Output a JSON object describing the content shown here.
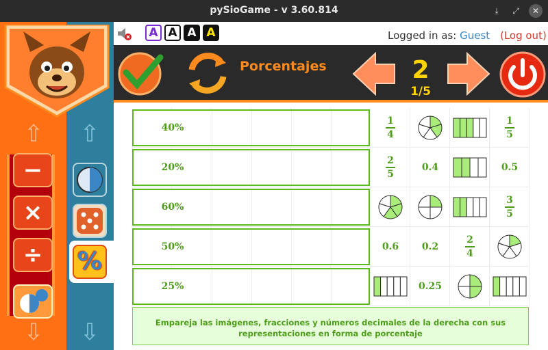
{
  "window": {
    "title": "pySioGame - v 3.60.814",
    "minimize_symbol": "⤓",
    "maximize_symbol": "⤢",
    "close_symbol": "✕"
  },
  "font_options": [
    {
      "label": "A",
      "bg": "#ffffff",
      "fg": "#7a2bd6",
      "border": "#7a2bd6"
    },
    {
      "label": "A",
      "bg": "#ffffff",
      "fg": "#111111",
      "border": "#111111"
    },
    {
      "label": "A",
      "bg": "#111111",
      "fg": "#ffffff",
      "border": "#111111"
    },
    {
      "label": "A",
      "bg": "#111111",
      "fg": "#ffe600",
      "border": "#111111"
    }
  ],
  "login": {
    "prefix": "Logged in as:",
    "user": "Guest",
    "logout": "(Log out)"
  },
  "toolbar": {
    "game_title": "Porcentajes",
    "level": "2",
    "progress": "1/5"
  },
  "nav": {
    "up_arrow": "⇧",
    "down_arrow": "⇩"
  },
  "operations": [
    {
      "symbol": "−",
      "name": "subtract"
    },
    {
      "symbol": "×",
      "name": "multiply"
    },
    {
      "symbol": "÷",
      "name": "divide"
    }
  ],
  "category_active_label": "%",
  "targets": [
    "40%",
    "20%",
    "60%",
    "50%",
    "25%"
  ],
  "choices": [
    [
      {
        "kind": "fraction",
        "num": "1",
        "den": "4"
      },
      {
        "kind": "pie",
        "slices": 5,
        "filled": 2
      },
      {
        "kind": "bar",
        "parts": 5,
        "filled": 3
      },
      {
        "kind": "fraction",
        "num": "1",
        "den": "5"
      }
    ],
    [
      {
        "kind": "fraction",
        "num": "2",
        "den": "5"
      },
      {
        "kind": "text",
        "value": "0.4"
      },
      {
        "kind": "bar",
        "parts": 4,
        "filled": 2
      },
      {
        "kind": "text",
        "value": "0.5"
      }
    ],
    [
      {
        "kind": "pie",
        "slices": 5,
        "filled": 3
      },
      {
        "kind": "pie",
        "slices": 4,
        "filled": 1
      },
      {
        "kind": "bar",
        "parts": 5,
        "filled": 2
      },
      {
        "kind": "fraction",
        "num": "3",
        "den": "5"
      }
    ],
    [
      {
        "kind": "text",
        "value": "0.6"
      },
      {
        "kind": "text",
        "value": "0.2"
      },
      {
        "kind": "fraction",
        "num": "2",
        "den": "4"
      },
      {
        "kind": "pie",
        "slices": 5,
        "filled": 1
      }
    ],
    [
      {
        "kind": "bar",
        "parts": 5,
        "filled": 1
      },
      {
        "kind": "text",
        "value": "0.25"
      },
      {
        "kind": "pie",
        "slices": 4,
        "filled": 2
      },
      {
        "kind": "bar",
        "parts": 5,
        "filled": 1
      }
    ]
  ],
  "instructions": "Empareja las imágenes, fracciones y números decimales de la derecha con sus representaciones en forma de porcentaje",
  "colors": {
    "orange": "#ff7014",
    "blue": "#2e7e9e",
    "green_text": "#4e9d1a",
    "green_border": "#5cba1c",
    "green_fill": "#a9ec7a",
    "yellow": "#ffd400"
  }
}
